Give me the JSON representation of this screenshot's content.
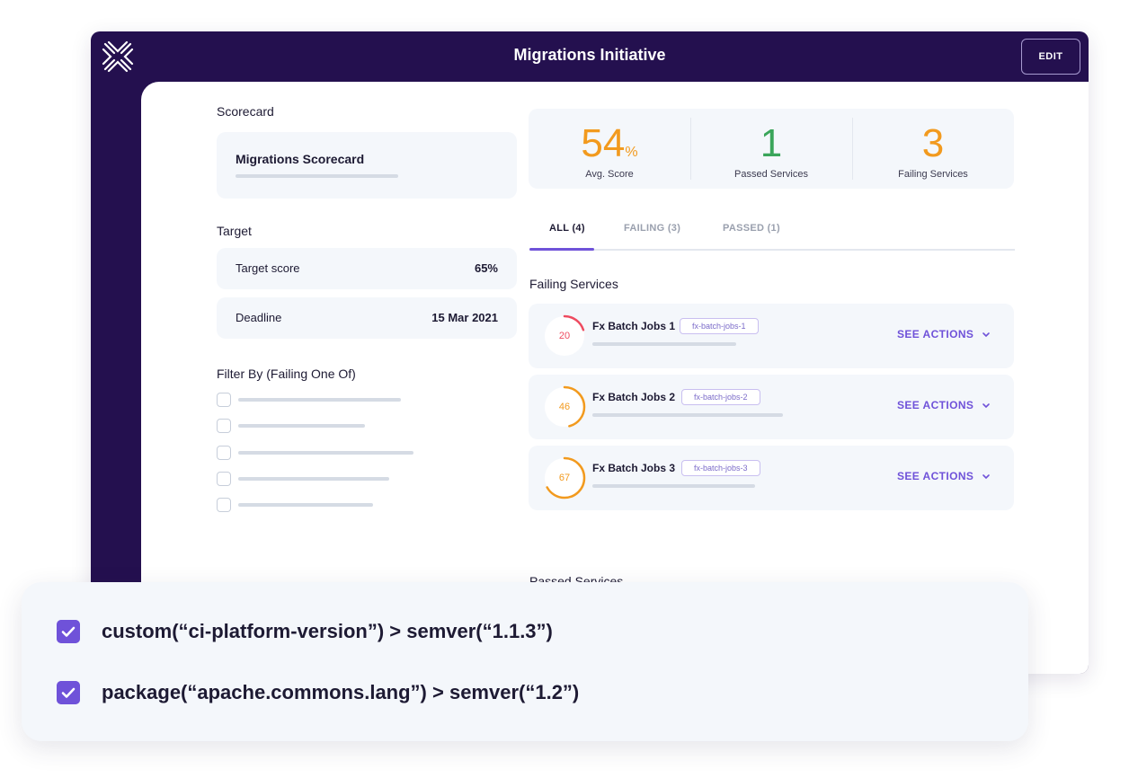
{
  "header": {
    "title": "Migrations Initiative",
    "edit_label": "EDIT"
  },
  "scorecard": {
    "label": "Scorecard",
    "name": "Migrations Scorecard"
  },
  "target": {
    "label": "Target",
    "rows": [
      {
        "key": "Target score",
        "value": "65%"
      },
      {
        "key": "Deadline",
        "value": "15 Mar 2021"
      }
    ]
  },
  "filter": {
    "label": "Filter By (Failing One Of)",
    "options_count_visible": 5
  },
  "stats": [
    {
      "value": "54",
      "unit": "%",
      "label": "Avg. Score",
      "color": "#f29a1e"
    },
    {
      "value": "1",
      "unit": "",
      "label": "Passed Services",
      "color": "#3aa55a"
    },
    {
      "value": "3",
      "unit": "",
      "label": "Failing Services",
      "color": "#f29a1e"
    }
  ],
  "tabs": [
    {
      "label": "ALL (4)",
      "active": true
    },
    {
      "label": "FAILING (3)",
      "active": false
    },
    {
      "label": "PASSED (1)",
      "active": false
    }
  ],
  "failing": {
    "label": "Failing Services",
    "services": [
      {
        "score": "20",
        "fraction": 0.2,
        "color": "#ee4b60",
        "name": "Fx Batch Jobs 1",
        "tag": "fx-batch-jobs-1",
        "action": "SEE ACTIONS"
      },
      {
        "score": "46",
        "fraction": 0.46,
        "color": "#f29a1e",
        "name": "Fx Batch Jobs 2",
        "tag": "fx-batch-jobs-2",
        "action": "SEE ACTIONS"
      },
      {
        "score": "67",
        "fraction": 0.67,
        "color": "#f29a1e",
        "name": "Fx Batch Jobs 3",
        "tag": "fx-batch-jobs-3",
        "action": "SEE ACTIONS"
      }
    ]
  },
  "passed": {
    "label": "Passed Services"
  },
  "rules": [
    {
      "checked": true,
      "text": "custom(“ci-platform-version”) > semver(“1.1.3”)"
    },
    {
      "checked": true,
      "text": "package(“apache.commons.lang”) > semver(“1.2”)"
    }
  ],
  "colors": {
    "brand_dark": "#24104f",
    "accent": "#6f52d9",
    "panel": "#f4f7fb"
  },
  "icons": {
    "logo": "cortex-logo-icon",
    "chevron": "chevron-down-icon",
    "check": "checkbox-checked-icon"
  }
}
